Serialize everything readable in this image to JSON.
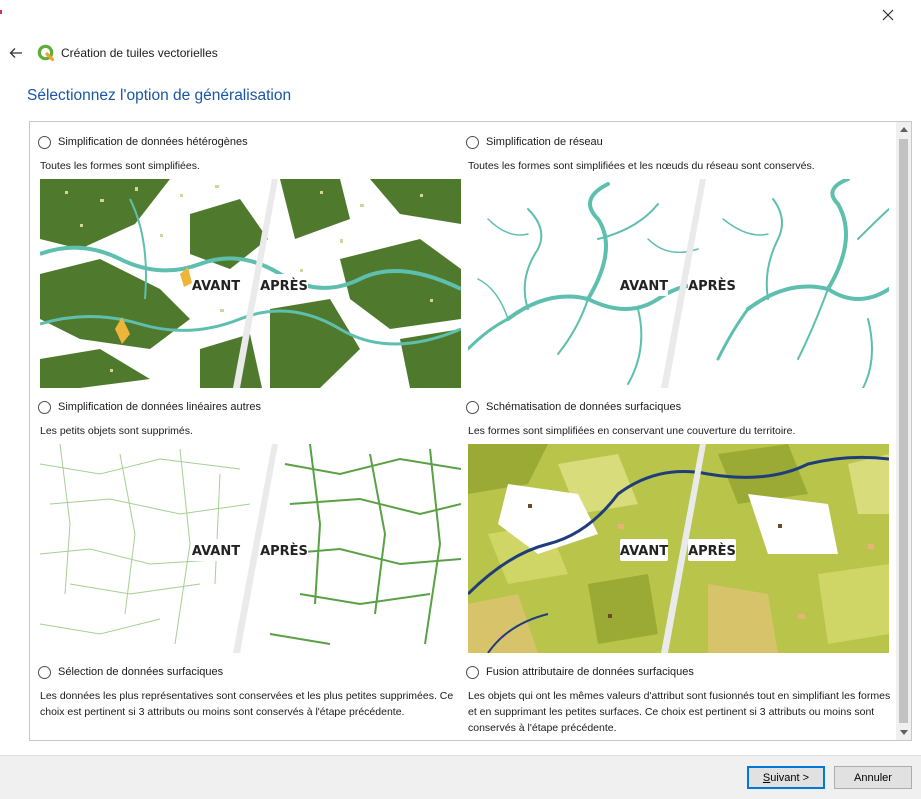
{
  "window": {
    "title": "Création de tuiles vectorielles"
  },
  "page": {
    "title": "Sélectionnez l'option de généralisation"
  },
  "badges": {
    "before": "AVANT",
    "after": "APRÈS"
  },
  "options": [
    {
      "label": "Simplification de données hétérogènes",
      "description": "Toutes les formes sont simplifiées."
    },
    {
      "label": "Simplification de réseau",
      "description": "Toutes les formes sont simplifiées et les nœuds du réseau sont conservés."
    },
    {
      "label": "Simplification de données linéaires autres",
      "description": "Les petits objets sont supprimés."
    },
    {
      "label": "Schématisation de données surfaciques",
      "description": "Les formes sont simplifiées en conservant une couverture du territoire."
    },
    {
      "label": "Sélection de données surfaciques",
      "description": "Les données les plus représentatives sont conservées et les plus petites supprimées. Ce choix est pertinent si 3 attributs ou moins sont conservés à l'étape précédente."
    },
    {
      "label": "Fusion attributaire de données surfaciques",
      "description": "Les objets qui ont les mêmes valeurs d'attribut sont fusionnés tout en simplifiant les formes et en supprimant les petites surfaces. Ce choix est pertinent si 3 attributs ou moins sont conservés à l'étape précédente."
    }
  ],
  "buttons": {
    "next_mnemonic": "S",
    "next_rest": "uivant >",
    "cancel": "Annuler"
  },
  "colors": {
    "title_blue": "#1a56a6",
    "forest_green": "#4f7a2e",
    "river_teal": "#5ebfae",
    "line_green": "#5aa045",
    "field_yellow": "#c6c85a",
    "water_navy": "#1f3d7a"
  }
}
